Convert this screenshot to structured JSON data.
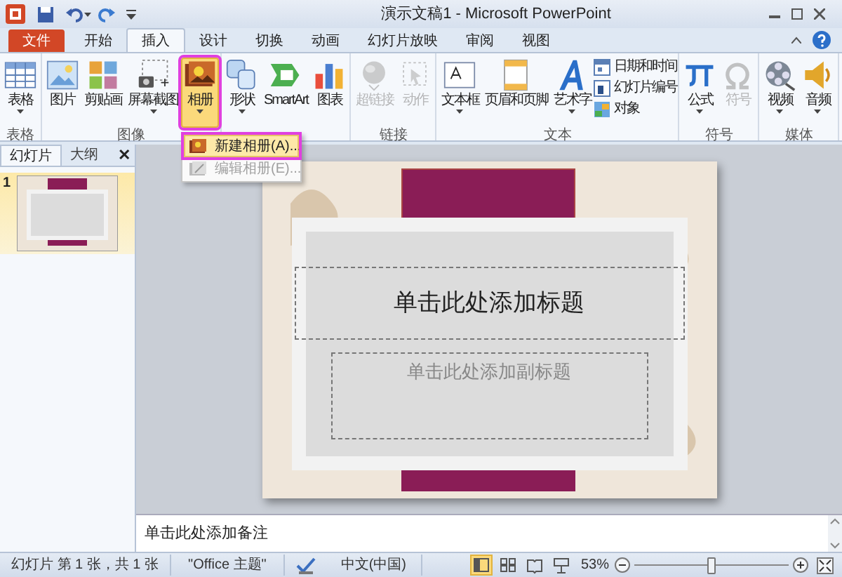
{
  "window": {
    "title": "演示文稿1 - Microsoft PowerPoint"
  },
  "file_tab": {
    "label": "文件"
  },
  "tabs": [
    {
      "label": "开始",
      "selected": false
    },
    {
      "label": "插入",
      "selected": true
    },
    {
      "label": "设计",
      "selected": false
    },
    {
      "label": "切换",
      "selected": false
    },
    {
      "label": "动画",
      "selected": false
    },
    {
      "label": "幻灯片放映",
      "selected": false
    },
    {
      "label": "审阅",
      "selected": false
    },
    {
      "label": "视图",
      "selected": false
    }
  ],
  "ribbon_groups": [
    {
      "label": "表格",
      "buttons": [
        {
          "label": "表格",
          "kind": "large",
          "dropdown": true,
          "disabled": false
        }
      ]
    },
    {
      "label": "图像",
      "buttons": [
        {
          "label": "图片",
          "kind": "large",
          "dropdown": false,
          "disabled": false
        },
        {
          "label": "剪贴画",
          "kind": "large",
          "dropdown": false,
          "disabled": false
        },
        {
          "label": "屏幕截图",
          "kind": "large",
          "dropdown": true,
          "disabled": false
        },
        {
          "label": "相册",
          "kind": "large",
          "dropdown": true,
          "disabled": false,
          "selected": true
        }
      ]
    },
    {
      "buttons": [
        {
          "label": "形状",
          "kind": "large",
          "dropdown": true,
          "disabled": false
        },
        {
          "label": "SmartArt",
          "kind": "large",
          "dropdown": false,
          "disabled": false
        },
        {
          "label": "图表",
          "kind": "large",
          "dropdown": false,
          "disabled": false
        }
      ]
    },
    {
      "label": "链接",
      "buttons": [
        {
          "label": "超链接",
          "kind": "large",
          "dropdown": false,
          "disabled": true
        },
        {
          "label": "动作",
          "kind": "large",
          "dropdown": false,
          "disabled": true
        }
      ]
    },
    {
      "label": "文本",
      "buttons": [
        {
          "label": "文本框",
          "kind": "large",
          "dropdown": true,
          "disabled": false
        },
        {
          "label": "页眉和页脚",
          "kind": "large",
          "dropdown": false,
          "disabled": false
        },
        {
          "label": "艺术字",
          "kind": "large",
          "dropdown": true,
          "disabled": false
        },
        {
          "label": "日期和时间",
          "kind": "small",
          "disabled": false
        },
        {
          "label": "幻灯片编号",
          "kind": "small",
          "disabled": false
        },
        {
          "label": "对象",
          "kind": "small",
          "disabled": false
        }
      ]
    },
    {
      "label": "符号",
      "buttons": [
        {
          "label": "公式",
          "kind": "large",
          "dropdown": true,
          "disabled": false
        },
        {
          "label": "符号",
          "kind": "large",
          "dropdown": false,
          "disabled": true
        }
      ]
    },
    {
      "label": "媒体",
      "buttons": [
        {
          "label": "视频",
          "kind": "large",
          "dropdown": true,
          "disabled": false
        },
        {
          "label": "音频",
          "kind": "large",
          "dropdown": true,
          "disabled": false
        }
      ]
    }
  ],
  "album_menu": [
    {
      "label": "新建相册(A)...",
      "selected": true,
      "disabled": false
    },
    {
      "label": "编辑相册(E)...",
      "selected": false,
      "disabled": true
    }
  ],
  "side_panel": {
    "tabs": [
      {
        "label": "幻灯片",
        "selected": true
      },
      {
        "label": "大纲",
        "selected": false
      }
    ],
    "close": "✕",
    "thumbnails": [
      {
        "number": "1",
        "selected": true
      }
    ]
  },
  "slide": {
    "title_placeholder": "单击此处添加标题",
    "subtitle_placeholder": "单击此处添加副标题"
  },
  "notes": {
    "placeholder": "单击此处添加备注"
  },
  "status_bar": {
    "slide_info": "幻灯片 第 1 张，共 1 张",
    "theme": "\"Office 主题\"",
    "language": "中文(中国)",
    "views": [
      {
        "selected": true
      },
      {
        "selected": false
      },
      {
        "selected": false
      },
      {
        "selected": false
      }
    ],
    "zoom": "53%",
    "zoom_slider": {
      "level": 0.5
    }
  }
}
